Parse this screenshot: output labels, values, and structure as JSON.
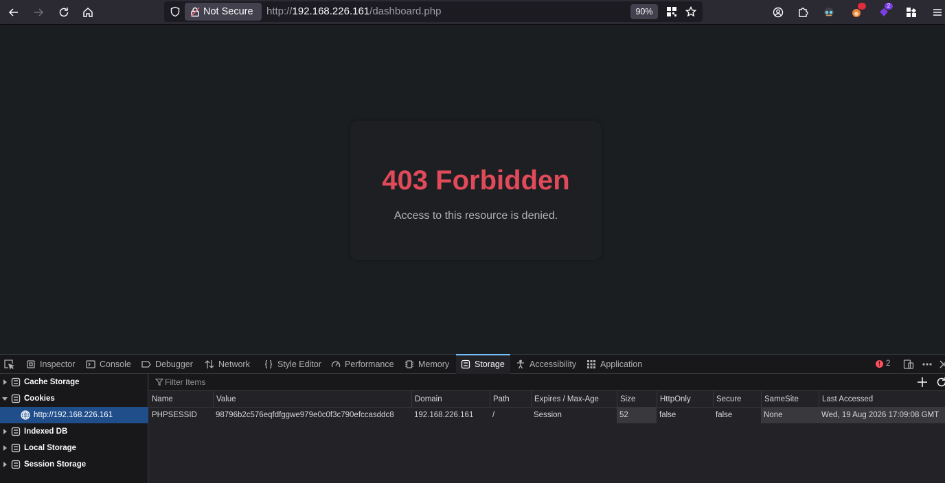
{
  "browser": {
    "not_secure_label": "Not Secure",
    "url_scheme": "http://",
    "url_host": "192.168.226.161",
    "url_path": "/dashboard.php",
    "zoom": "90%",
    "extension_badge_1": "",
    "extension_badge_2": "2"
  },
  "page": {
    "error_title": "403 Forbidden",
    "error_message": "Access to this resource is denied.",
    "error_title_color": "#e04a59"
  },
  "devtools": {
    "tabs": [
      "Inspector",
      "Console",
      "Debugger",
      "Network",
      "Style Editor",
      "Performance",
      "Memory",
      "Storage",
      "Accessibility",
      "Application"
    ],
    "active_tab": "Storage",
    "error_count": "2",
    "sidebar": {
      "items": [
        "Cache Storage",
        "Cookies",
        "http://192.168.226.161",
        "Indexed DB",
        "Local Storage",
        "Session Storage"
      ],
      "selected": "http://192.168.226.161"
    },
    "filter_placeholder": "Filter Items",
    "table": {
      "headers": [
        "Name",
        "Value",
        "Domain",
        "Path",
        "Expires / Max-Age",
        "Size",
        "HttpOnly",
        "Secure",
        "SameSite",
        "Last Accessed"
      ],
      "rows": [
        [
          "PHPSESSID",
          "98796b2c576eqfdfggwe979e0c0f3c790efccasddc8",
          "192.168.226.161",
          "/",
          "Session",
          "52",
          "false",
          "false",
          "None",
          "Wed, 19 Aug 2026 17:09:08 GMT"
        ]
      ]
    },
    "accent_color": "#75bfff"
  }
}
